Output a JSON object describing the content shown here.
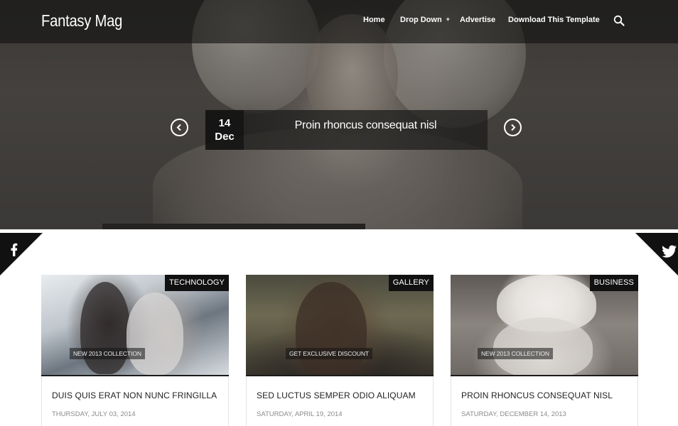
{
  "header": {
    "brand": "Fantasy Mag",
    "nav": [
      {
        "label": "Home"
      },
      {
        "label": "Drop Down"
      },
      {
        "label": "Advertise"
      },
      {
        "label": "Download This Template"
      }
    ],
    "dropdown_caret": "+",
    "search_icon": "search-icon"
  },
  "slider": {
    "day": "14",
    "month": "Dec",
    "title": "Proin rhoncus consequat nisl",
    "prev_icon": "chevron-left-icon",
    "next_icon": "chevron-right-icon"
  },
  "social": {
    "left_icon": "facebook-icon",
    "right_icon": "twitter-icon"
  },
  "posts": [
    {
      "category": "TECHNOLOGY",
      "image_label": "NEW 2013 COLLECTION",
      "title": "DUIS QUIS ERAT NON NUNC FRINGILLA",
      "date": "THURSDAY, JULY 03, 2014"
    },
    {
      "category": "GALLERY",
      "image_label": "GET EXCLUSIVE DISCOUNT",
      "title": "SED LUCTUS SEMPER ODIO ALIQUAM",
      "date": "SATURDAY, APRIL 19, 2014"
    },
    {
      "category": "BUSINESS",
      "image_label": "NEW 2013 COLLECTION",
      "title": "PROIN RHONCUS CONSEQUAT NISL",
      "date": "SATURDAY, DECEMBER 14, 2013"
    }
  ],
  "colors": {
    "header_bg": "#121110",
    "badge_bg": "#111111",
    "text_dark": "#222222",
    "text_muted": "#8a8a8a"
  }
}
